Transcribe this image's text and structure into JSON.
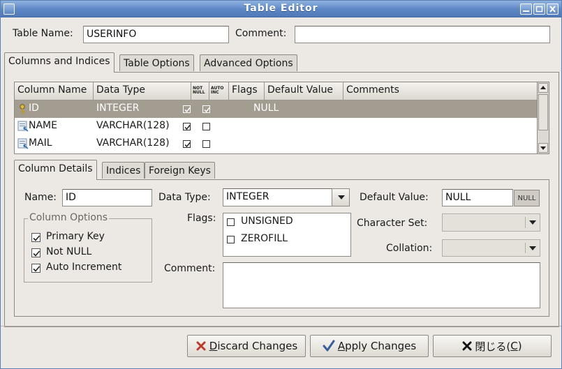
{
  "window": {
    "title": "Table Editor"
  },
  "header": {
    "table_name_label": "Table Name:",
    "table_name_value": "USERINFO",
    "comment_label": "Comment:",
    "comment_value": ""
  },
  "main_tabs": [
    "Columns and Indices",
    "Table Options",
    "Advanced Options"
  ],
  "grid": {
    "headers": [
      "Column Name",
      "Data Type",
      "NOT NULL",
      "AUTO INC",
      "Flags",
      "Default Value",
      "Comments"
    ],
    "header_short": {
      "not_null_1": "NOT",
      "not_null_2": "NULL",
      "auto_inc_1": "AUTO",
      "auto_inc_2": "INC"
    },
    "rows": [
      {
        "name": "ID",
        "type": "INTEGER",
        "not_null": true,
        "auto_inc": true,
        "flags": "",
        "default": "NULL",
        "comments": "",
        "selected": true,
        "icon": "key-icon"
      },
      {
        "name": "NAME",
        "type": "VARCHAR(128)",
        "not_null": true,
        "auto_inc": false,
        "flags": "",
        "default": "",
        "comments": "",
        "selected": false,
        "icon": "column-icon"
      },
      {
        "name": "MAIL",
        "type": "VARCHAR(128)",
        "not_null": true,
        "auto_inc": false,
        "flags": "",
        "default": "",
        "comments": "",
        "selected": false,
        "icon": "column-icon"
      }
    ]
  },
  "detail_tabs": [
    "Column Details",
    "Indices",
    "Foreign Keys"
  ],
  "details": {
    "name_label": "Name:",
    "name_value": "ID",
    "data_type_label": "Data Type:",
    "data_type_value": "INTEGER",
    "default_value_label": "Default Value:",
    "default_value": "NULL",
    "null_button": "NULL",
    "column_options_title": "Column Options",
    "options": [
      {
        "label": "Primary Key",
        "checked": true
      },
      {
        "label": "Not NULL",
        "checked": true
      },
      {
        "label": "Auto Increment",
        "checked": true
      }
    ],
    "flags_label": "Flags:",
    "flags": [
      {
        "label": "UNSIGNED",
        "checked": false
      },
      {
        "label": "ZEROFILL",
        "checked": false
      }
    ],
    "character_set_label": "Character Set:",
    "character_set_value": "",
    "collation_label": "Collation:",
    "collation_value": "",
    "comment_label": "Comment:",
    "comment_value": ""
  },
  "buttons": {
    "discard_prefix": "",
    "discard_mnemonic": "D",
    "discard_rest": "iscard Changes",
    "apply_mnemonic": "A",
    "apply_rest": "pply Changes",
    "close_main": "閉じる(",
    "close_mnemonic": "C",
    "close_end": ")"
  },
  "colors": {
    "titlebar": "#5c86c4",
    "selected_row": "#a39c91",
    "window_bg": "#ece9e4"
  }
}
